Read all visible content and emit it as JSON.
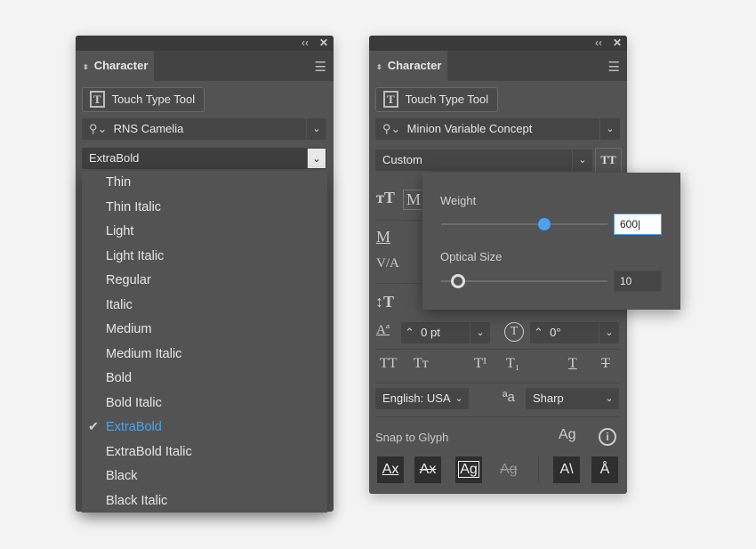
{
  "left": {
    "title": "Character",
    "touch_type": "Touch Type Tool",
    "font_family": "RNS Camelia",
    "font_style": "ExtraBold",
    "styles": [
      "Thin",
      "Thin Italic",
      "Light",
      "Light Italic",
      "Regular",
      "Italic",
      "Medium",
      "Medium Italic",
      "Bold",
      "Bold Italic",
      "ExtraBold",
      "ExtraBold Italic",
      "Black",
      "Black Italic"
    ],
    "selected_style": "ExtraBold"
  },
  "right": {
    "title": "Character",
    "touch_type": "Touch Type Tool",
    "font_family": "Minion Variable Concept",
    "font_style": "Custom",
    "baseline": "0 pt",
    "rotation": "0°",
    "language": "English: USA",
    "antialias": "Sharp",
    "snap_label": "Snap to Glyph",
    "popover": {
      "weight_label": "Weight",
      "weight_value": "600",
      "weight_fraction": 0.62,
      "optical_label": "Optical Size",
      "optical_value": "10",
      "optical_fraction": 0.1
    }
  },
  "colors": {
    "accent": "#4aa3f0",
    "panel": "#535353"
  }
}
